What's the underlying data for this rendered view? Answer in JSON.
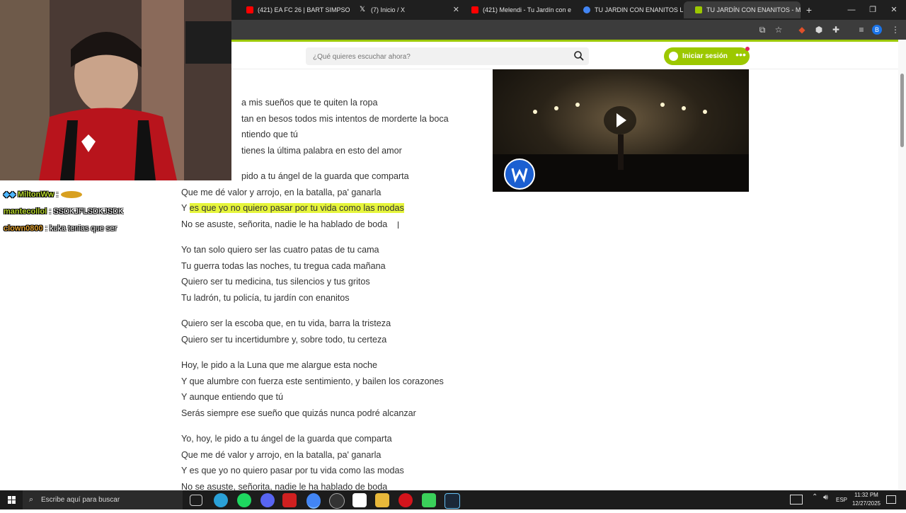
{
  "browser": {
    "tabs": [
      {
        "title": "(421) EA FC 26 | BART SIMPSON",
        "favicon_color": "#ff0000"
      },
      {
        "title": "(7) Inicio / X",
        "favicon_color": "#ffffff"
      },
      {
        "title": "(421) Melendi - Tu Jardín con e",
        "favicon_color": "#ff0000"
      },
      {
        "title": "TU JARDIN CON ENANITOS LE",
        "favicon_color": "#4285f4"
      },
      {
        "title": "TU JARDÍN CON ENANITOS - M",
        "favicon_color": "#9cc800"
      }
    ],
    "new_tab_label": "+",
    "window_controls": {
      "minimize": "—",
      "restore": "❐",
      "close": "✕"
    },
    "profile_initial": "B"
  },
  "site": {
    "search_placeholder": "¿Qué quieres escuchar ahora?",
    "login_label": "Iniciar sesión",
    "more_label": "•••",
    "accent_color": "#9cc800"
  },
  "lyrics": {
    "lines_partial": [
      "a mis sueños que te quiten la ropa",
      "tan en besos todos mis intentos de morderte la boca",
      "ntiendo que tú",
      "tienes la última palabra en esto del amor",
      "pido a tu ángel de la guarda que comparta"
    ],
    "lines": [
      "Que me dé valor y arrojo, en la batalla, pa' ganarla",
      "No se asuste, señorita, nadie le ha hablado de boda",
      "Yo tan solo quiero ser las cuatro patas de tu cama",
      "Tu guerra todas las noches, tu tregua cada mañana",
      "Quiero ser tu medicina, tus silencios y tus gritos",
      "Tu ladrón, tu policía, tu jardín con enanitos",
      "Quiero ser la escoba que, en tu vida, barra la tristeza",
      "Quiero ser tu incertidumbre y, sobre todo, tu certeza",
      "Hoy, le pido a la Luna que me alargue esta noche",
      "Y que alumbre con fuerza este sentimiento, y bailen los corazones",
      "Y aunque entiendo que tú",
      "Serás siempre ese sueño que quizás nunca podré alcanzar",
      "Yo, hoy, le pido a tu ángel de la guarda que comparta",
      "Que me dé valor y arrojo, en la batalla, pa' ganarla",
      "Y es que yo no quiero pasar por tu vida como las modas",
      "No se asuste, señorita, nadie le ha hablado de boda"
    ],
    "highlighted_prefix": "Y ",
    "highlighted_text": "es que yo no quiero pasar por tu vida como las modas",
    "highlight_color": "#e6f53c"
  },
  "chat": [
    {
      "user": "MiltonWw",
      "message": ":"
    },
    {
      "user": "mantecollol",
      "message": ": SSDKJFLSDKJSDK"
    },
    {
      "user": "clown0800",
      "message": ": kuka tenias que ser"
    }
  ],
  "taskbar": {
    "search_placeholder": "Escribe aquí para buscar",
    "language": "ESP",
    "time": "11:32 PM",
    "date": "12/27/2025"
  }
}
